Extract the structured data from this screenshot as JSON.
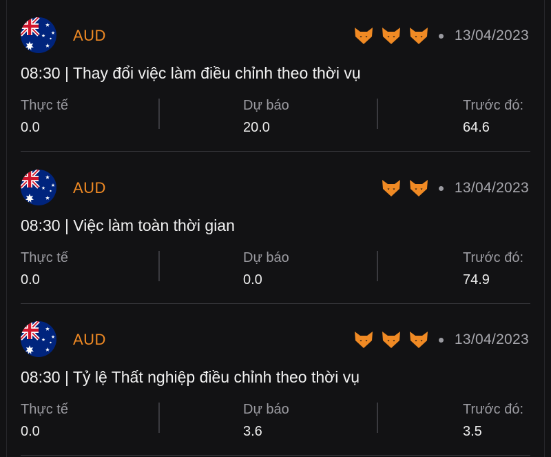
{
  "labels": {
    "actual": "Thực tế",
    "forecast": "Dự báo",
    "previous": "Trước đó:"
  },
  "colors": {
    "background": "#121214",
    "accent_orange": "#f08a24",
    "muted_text": "#9b9ba1",
    "divider": "#38383d"
  },
  "events": [
    {
      "flag_icon": "australia-flag-icon",
      "currency": "AUD",
      "impact_level": 3,
      "impact_icon": "bull-head-icon",
      "date": "13/04/2023",
      "title": "08:30 | Thay đổi việc làm điều chỉnh theo thời vụ",
      "actual": "0.0",
      "forecast": "20.0",
      "previous": "64.6"
    },
    {
      "flag_icon": "australia-flag-icon",
      "currency": "AUD",
      "impact_level": 2,
      "impact_icon": "bull-head-icon",
      "date": "13/04/2023",
      "title": "08:30 | Việc làm toàn thời gian",
      "actual": "0.0",
      "forecast": "0.0",
      "previous": "74.9"
    },
    {
      "flag_icon": "australia-flag-icon",
      "currency": "AUD",
      "impact_level": 3,
      "impact_icon": "bull-head-icon",
      "date": "13/04/2023",
      "title": "08:30 | Tỷ lệ Thất nghiệp điều chỉnh theo thời vụ",
      "actual": "0.0",
      "forecast": "3.6",
      "previous": "3.5"
    }
  ]
}
